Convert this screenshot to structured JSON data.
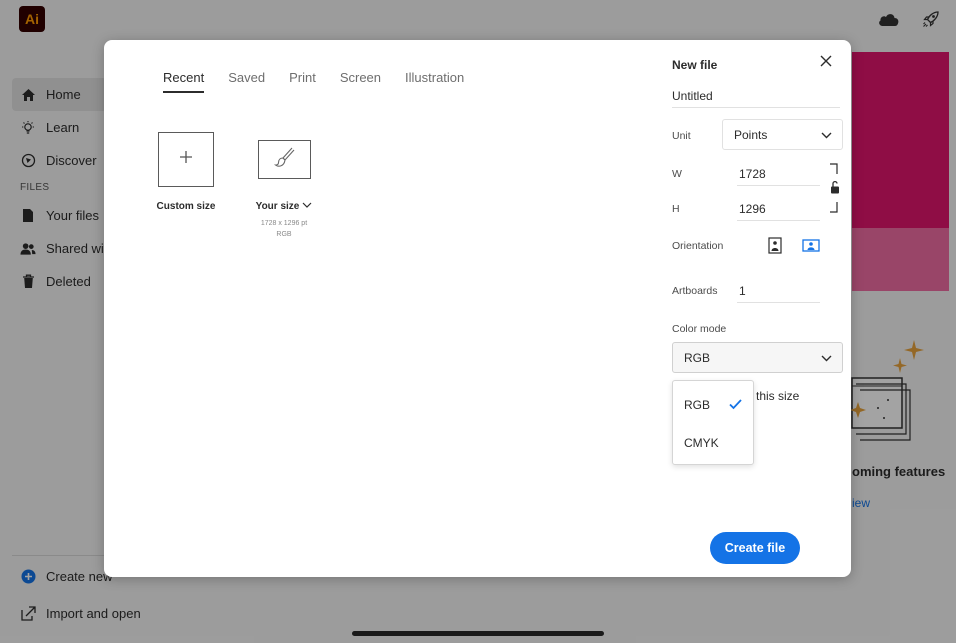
{
  "app": {
    "logo_text": "Ai",
    "icons": [
      "cloud-icon",
      "rocket-icon"
    ]
  },
  "sidebar": {
    "items": [
      {
        "label": "Home",
        "icon": "home-icon"
      },
      {
        "label": "Learn",
        "icon": "lightbulb-icon"
      },
      {
        "label": "Discover",
        "icon": "discover-icon"
      }
    ],
    "files_section": "FILES",
    "file_items": [
      {
        "label": "Your files",
        "icon": "file-icon"
      },
      {
        "label": "Shared wit",
        "icon": "shared-icon"
      },
      {
        "label": "Deleted",
        "icon": "trash-icon"
      }
    ],
    "create_new": "Create new",
    "import_open": "Import and open"
  },
  "promo": {
    "title": "oming features",
    "link": "iew"
  },
  "dialog": {
    "tabs": [
      "Recent",
      "Saved",
      "Print",
      "Screen",
      "Illustration"
    ],
    "active_tab": "Recent",
    "presets": [
      {
        "label": "Custom size"
      },
      {
        "label": "Your size",
        "size": "1728 x 1296 pt",
        "mode": "RGB"
      }
    ],
    "panel": {
      "title": "New file",
      "name_value": "Untitled",
      "unit_label": "Unit",
      "unit_value": "Points",
      "w_label": "W",
      "w_value": "1728",
      "h_label": "H",
      "h_value": "1296",
      "orientation_label": "Orientation",
      "artboards_label": "Artboards",
      "artboards_value": "1",
      "color_mode_label": "Color mode",
      "color_mode_value": "RGB",
      "color_mode_options": [
        "RGB",
        "CMYK"
      ],
      "behind_text": "this size",
      "create_label": "Create file"
    }
  },
  "colors": {
    "accent": "#1473e6",
    "banner_top": "#e0156d",
    "banner_bottom": "#ef6da3",
    "promo_orange": "#e8a33d"
  }
}
